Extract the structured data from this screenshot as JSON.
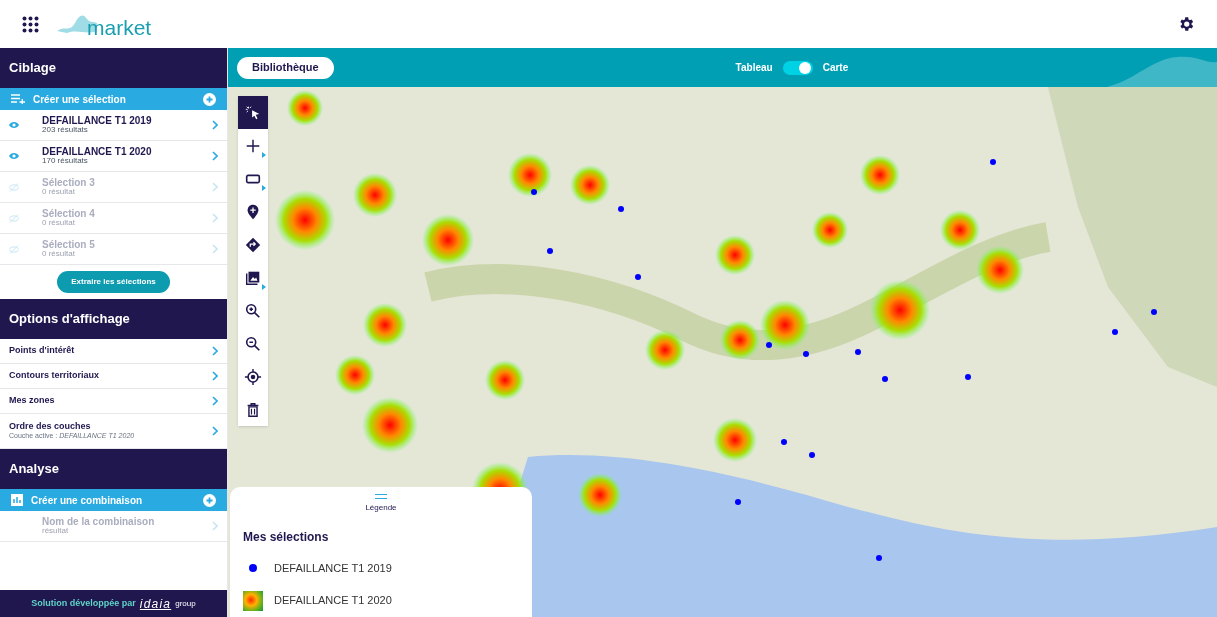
{
  "header": {
    "logo_text": "market"
  },
  "sidebar": {
    "targeting": {
      "title": "Ciblage",
      "create_label": "Créer une sélection",
      "selections": [
        {
          "name": "DEFAILLANCE T1 2019",
          "count": "203 résultats",
          "visible": true
        },
        {
          "name": "DEFAILLANCE T1 2020",
          "count": "170 résultats",
          "visible": true
        },
        {
          "name": "Sélection 3",
          "count": "0 résultat",
          "visible": false
        },
        {
          "name": "Sélection 4",
          "count": "0 résultat",
          "visible": false
        },
        {
          "name": "Sélection 5",
          "count": "0 résultat",
          "visible": false
        }
      ],
      "extract_button": "Extraire les sélections"
    },
    "display_options": {
      "title": "Options d'affichage",
      "items": [
        {
          "label": "Points d'intérêt"
        },
        {
          "label": "Contours territoriaux"
        },
        {
          "label": "Mes zones"
        },
        {
          "label": "Ordre des couches",
          "sublabel": "Couche active : *DEFAILLANCE T1 2020*"
        }
      ]
    },
    "analysis": {
      "title": "Analyse",
      "create_label": "Créer une combinaison",
      "combinations": [
        {
          "name": "Nom de la combinaison",
          "count": "résultat",
          "visible": false
        }
      ]
    },
    "footer": {
      "text": "Solution développée par",
      "brand": "idaia",
      "brand_suffix": "group"
    }
  },
  "map_bar": {
    "library_button": "Bibliothèque",
    "view_toggle": {
      "left_label": "Tableau",
      "right_label": "Carte",
      "on": true
    }
  },
  "tools": [
    {
      "kind": "select",
      "selected": true,
      "submenu": false
    },
    {
      "kind": "point",
      "selected": false,
      "submenu": true
    },
    {
      "kind": "rectangle",
      "selected": false,
      "submenu": true
    },
    {
      "kind": "marker",
      "selected": false,
      "submenu": false
    },
    {
      "kind": "route",
      "selected": false,
      "submenu": false
    },
    {
      "kind": "image",
      "selected": false,
      "submenu": true
    },
    {
      "kind": "zoom_in",
      "selected": false,
      "submenu": false
    },
    {
      "kind": "zoom_out",
      "selected": false,
      "submenu": false
    },
    {
      "kind": "locate",
      "selected": false,
      "submenu": false
    },
    {
      "kind": "delete",
      "selected": false,
      "submenu": false
    }
  ],
  "legend": {
    "toggle_label": "Légende",
    "title": "Mes sélections",
    "items": [
      {
        "kind": "dot",
        "label": "DEFAILLANCE T1 2019",
        "color": "#0000ff"
      },
      {
        "kind": "heatmap",
        "label": "DEFAILLANCE T1 2020"
      }
    ]
  }
}
